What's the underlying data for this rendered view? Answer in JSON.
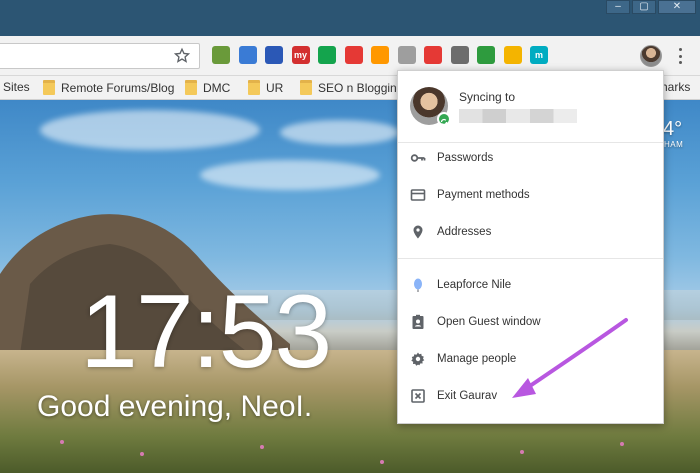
{
  "browser": {
    "window_controls": [
      "–",
      "▢",
      "✕"
    ],
    "extensions": [
      {
        "name": "ext-green-square",
        "color": "#6a9a3a"
      },
      {
        "name": "ext-diamond",
        "color": "#3a7bd5"
      },
      {
        "name": "ext-blue-box",
        "color": "#2b58b6"
      },
      {
        "name": "ext-my",
        "color": "#d32f2f",
        "label": "my"
      },
      {
        "name": "ext-grammarly",
        "color": "#14a44d"
      },
      {
        "name": "ext-shield-red",
        "color": "#e53935"
      },
      {
        "name": "ext-colorful",
        "color": "#ff9800"
      },
      {
        "name": "ext-gray-shield",
        "color": "#9e9e9e"
      },
      {
        "name": "ext-red-diag",
        "color": "#e53935"
      },
      {
        "name": "ext-gray-box",
        "color": "#6d6d6d"
      },
      {
        "name": "ext-green-d",
        "color": "#2e9b3e"
      },
      {
        "name": "ext-drive",
        "color": "#f4b400"
      },
      {
        "name": "ext-m",
        "color": "#00acc1",
        "label": "m"
      }
    ]
  },
  "bookmarks": [
    {
      "label": "Sites",
      "folder": false
    },
    {
      "label": "Remote Forums/Blog",
      "folder": true
    },
    {
      "label": "DMC",
      "folder": true
    },
    {
      "label": "UR",
      "folder": true
    },
    {
      "label": "SEO n Blogging",
      "folder": true
    },
    {
      "label": "harks",
      "folder": false
    }
  ],
  "newtab": {
    "time": "17:53",
    "greeting": "Good evening, NeoI.",
    "weather_temp": "4°",
    "weather_city": "HAM"
  },
  "profile_menu": {
    "sync_title": "Syncing to",
    "sections": [
      [
        {
          "label": "Passwords",
          "icon": "key-icon"
        },
        {
          "label": "Payment methods",
          "icon": "credit-card-icon"
        },
        {
          "label": "Addresses",
          "icon": "location-pin-icon"
        }
      ],
      [
        {
          "label": "Leapforce Nile",
          "icon": "profile-balloon-icon"
        },
        {
          "label": "Open Guest window",
          "icon": "guest-badge-icon"
        },
        {
          "label": "Manage people",
          "icon": "gear-icon"
        },
        {
          "label": "Exit Gaurav",
          "icon": "exit-icon"
        }
      ]
    ]
  },
  "colors": {
    "titlebar": "#2c5573",
    "menu_text": "#333333",
    "icon_gray": "#5f6368",
    "annotation_arrow": "#b857e0"
  }
}
